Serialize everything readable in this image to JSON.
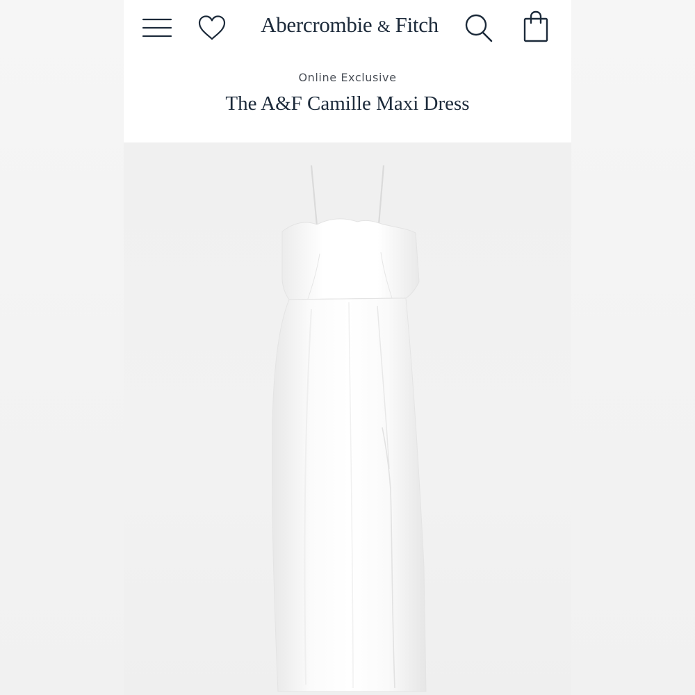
{
  "header": {
    "brand_name": "Abercrombie",
    "brand_amp": "&",
    "brand_suffix": "Fitch",
    "icons": [
      "menu-icon",
      "heart-icon",
      "search-icon",
      "shopping-bag-icon"
    ]
  },
  "product": {
    "badge": "Online Exclusive",
    "title": "The A&F Camille Maxi Dress",
    "image_alt_color": "#ffffff"
  },
  "colors": {
    "brand_navy": "#1c2a3a",
    "badge_gray": "#4a4f57",
    "background": "#f4f4f4"
  }
}
